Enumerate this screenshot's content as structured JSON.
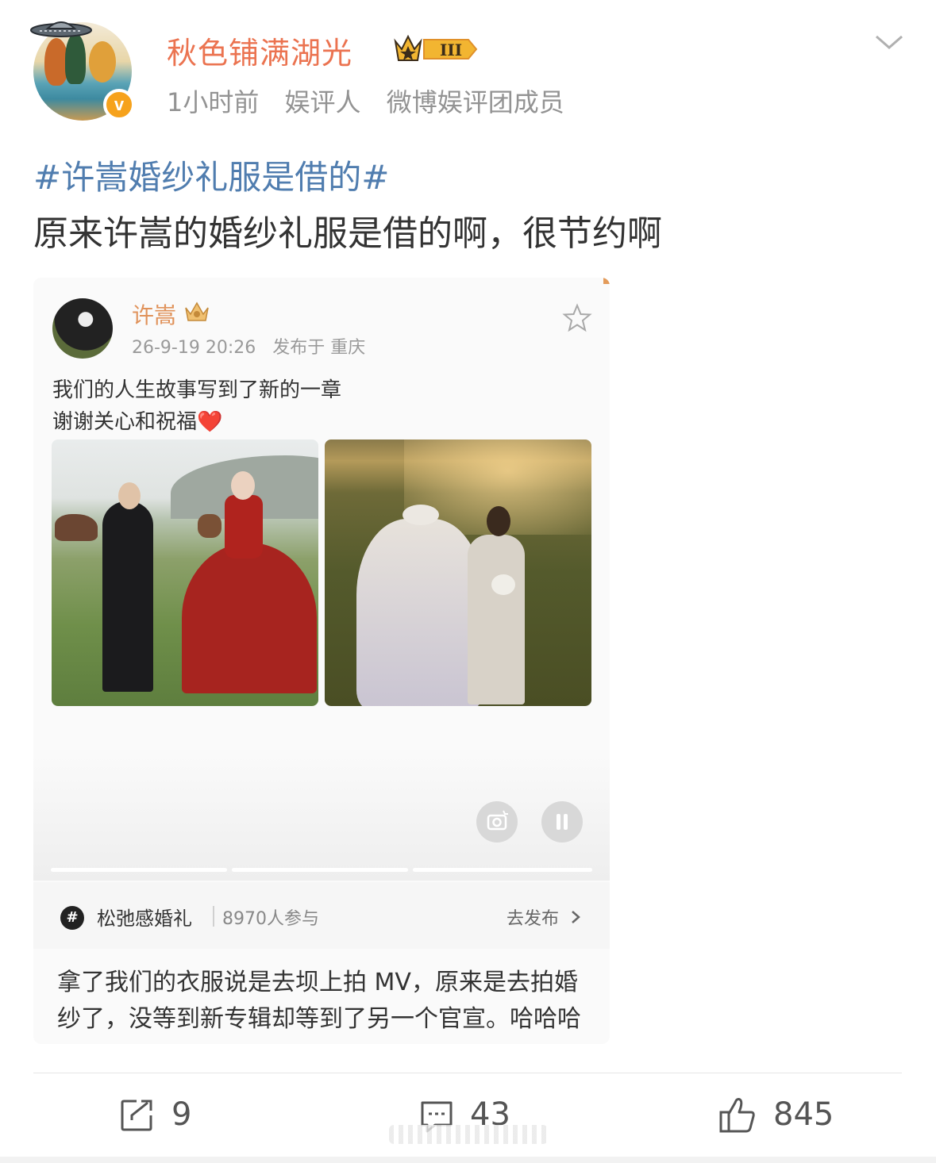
{
  "post": {
    "author": "秋色铺满湖光",
    "time": "1小时前",
    "tag1": "娱评人",
    "tag2": "微博娱评团成员",
    "vip_level": "III",
    "hashtag": "#许嵩婚纱礼服是借的#",
    "text": "原来许嵩的婚纱礼服是借的啊，很节约啊"
  },
  "embed": {
    "author": "许嵩",
    "date": "26-9-19 20:26",
    "location": "发布于 重庆",
    "line1": "我们的人生故事写到了新的一章",
    "line2": "谢谢关心和祝福",
    "heart": "❤️",
    "topic": {
      "icon": "#",
      "name": "松弛感婚礼",
      "count": "8970人参与",
      "action": "去发布"
    },
    "comment_line1": "拿了我们的衣服说是去坝上拍 MV，原来是去拍婚",
    "comment_line2": "纱了，没等到新专辑却等到了另一个官宣。哈哈哈"
  },
  "actions": {
    "repost_count": "9",
    "comment_count": "43",
    "like_count": "845"
  },
  "colors": {
    "username": "#eb7350",
    "hashtag": "#507daf",
    "verified_badge": "#f6a21c"
  }
}
